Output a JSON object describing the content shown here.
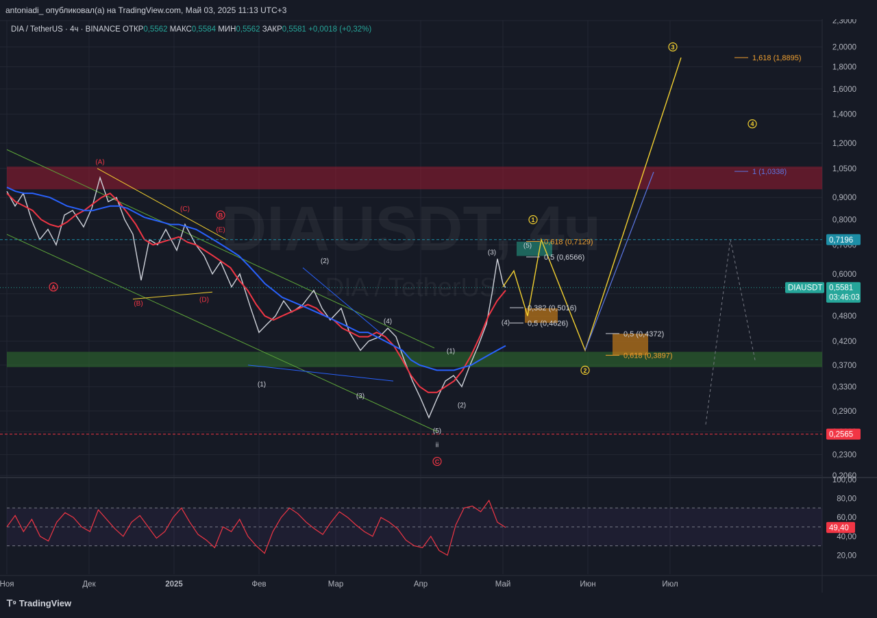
{
  "header": {
    "publisher": "antoniadi_ опубликовал(а) на TradingView.com, Май 03, 2025 11:13 UTC+3"
  },
  "legend": {
    "symbol": "DIA / TetherUS · 4ч · BINANCE",
    "open_label": "ОТКР",
    "open": "0,5562",
    "high_label": "МАКС",
    "high": "0,5584",
    "low_label": "МИН",
    "low": "0,5562",
    "close_label": "ЗАКР",
    "close": "0,5581",
    "change": "+0,0018 (+0,32%)"
  },
  "watermark": {
    "symbol": "DIAUSDT, 4ч",
    "name": "DIA / TetherUS"
  },
  "footer": {
    "brand": "TradingView"
  },
  "colors": {
    "background": "#161a25",
    "grid": "#232733",
    "candles": "#d1d4dc",
    "ma_fast": "#f23645",
    "ma_slow": "#2962ff",
    "projection": "#f5d230",
    "channel": "#5fa83a",
    "rsi": "#f23645",
    "resistance_zone": "#9b1c31",
    "support_zone": "#2e6b2e",
    "fib_box": "#b8741a",
    "price_tag": "#26a69a"
  },
  "chart_data": {
    "type": "line",
    "scale": "log",
    "y_ticks": [
      "2,3000",
      "2,0000",
      "1,8000",
      "1,6000",
      "1,4000",
      "1,2000",
      "1,0500",
      "0,9000",
      "0,8000",
      "0,7000",
      "0,6000",
      "0,5400",
      "0,4800",
      "0,4200",
      "0,3700",
      "0,3300",
      "0,2900",
      "0,2600",
      "0,2300",
      "0,2060"
    ],
    "y_tick_values": [
      2.3,
      2.0,
      1.8,
      1.6,
      1.4,
      1.2,
      1.05,
      0.9,
      0.8,
      0.7,
      0.6,
      0.54,
      0.48,
      0.42,
      0.37,
      0.33,
      0.29,
      0.26,
      0.23,
      0.206
    ],
    "x_ticks": [
      "Ноя",
      "Дек",
      "2025",
      "Фев",
      "Мар",
      "Апр",
      "Май",
      "Июн",
      "Июл"
    ],
    "x_tick_days": [
      0,
      30,
      61,
      92,
      120,
      151,
      181,
      212,
      242
    ],
    "price_path": [
      {
        "d": 0,
        "p": 0.93
      },
      {
        "d": 3,
        "p": 0.86
      },
      {
        "d": 6,
        "p": 0.92
      },
      {
        "d": 9,
        "p": 0.8
      },
      {
        "d": 12,
        "p": 0.72
      },
      {
        "d": 15,
        "p": 0.76
      },
      {
        "d": 18,
        "p": 0.7
      },
      {
        "d": 21,
        "p": 0.82
      },
      {
        "d": 24,
        "p": 0.84
      },
      {
        "d": 28,
        "p": 0.77
      },
      {
        "d": 31,
        "p": 0.85
      },
      {
        "d": 34,
        "p": 1.0
      },
      {
        "d": 37,
        "p": 0.88
      },
      {
        "d": 40,
        "p": 0.9
      },
      {
        "d": 43,
        "p": 0.8
      },
      {
        "d": 46,
        "p": 0.74
      },
      {
        "d": 49,
        "p": 0.58
      },
      {
        "d": 52,
        "p": 0.72
      },
      {
        "d": 55,
        "p": 0.7
      },
      {
        "d": 58,
        "p": 0.76
      },
      {
        "d": 62,
        "p": 0.68
      },
      {
        "d": 65,
        "p": 0.78
      },
      {
        "d": 69,
        "p": 0.7
      },
      {
        "d": 72,
        "p": 0.66
      },
      {
        "d": 75,
        "p": 0.6
      },
      {
        "d": 78,
        "p": 0.64
      },
      {
        "d": 82,
        "p": 0.56
      },
      {
        "d": 85,
        "p": 0.6
      },
      {
        "d": 89,
        "p": 0.5
      },
      {
        "d": 92,
        "p": 0.44
      },
      {
        "d": 95,
        "p": 0.46
      },
      {
        "d": 98,
        "p": 0.48
      },
      {
        "d": 101,
        "p": 0.52
      },
      {
        "d": 104,
        "p": 0.49
      },
      {
        "d": 108,
        "p": 0.51
      },
      {
        "d": 112,
        "p": 0.55
      },
      {
        "d": 115,
        "p": 0.5
      },
      {
        "d": 118,
        "p": 0.47
      },
      {
        "d": 122,
        "p": 0.5
      },
      {
        "d": 125,
        "p": 0.44
      },
      {
        "d": 129,
        "p": 0.4
      },
      {
        "d": 132,
        "p": 0.42
      },
      {
        "d": 136,
        "p": 0.43
      },
      {
        "d": 139,
        "p": 0.45
      },
      {
        "d": 142,
        "p": 0.43
      },
      {
        "d": 145,
        "p": 0.38
      },
      {
        "d": 148,
        "p": 0.34
      },
      {
        "d": 151,
        "p": 0.31
      },
      {
        "d": 154,
        "p": 0.28
      },
      {
        "d": 157,
        "p": 0.31
      },
      {
        "d": 160,
        "p": 0.34
      },
      {
        "d": 163,
        "p": 0.35
      },
      {
        "d": 166,
        "p": 0.33
      },
      {
        "d": 169,
        "p": 0.37
      },
      {
        "d": 172,
        "p": 0.41
      },
      {
        "d": 175,
        "p": 0.46
      },
      {
        "d": 177,
        "p": 0.54
      },
      {
        "d": 179,
        "p": 0.65
      },
      {
        "d": 181,
        "p": 0.57
      },
      {
        "d": 182,
        "p": 0.558
      }
    ],
    "series": [
      {
        "name": "",
        "color": "#f23645",
        "values": [
          0.92,
          0.88,
          0.86,
          0.84,
          0.8,
          0.78,
          0.77,
          0.79,
          0.82,
          0.84,
          0.87,
          0.9,
          0.92,
          0.88,
          0.83,
          0.78,
          0.72,
          0.7,
          0.71,
          0.72,
          0.73,
          0.71,
          0.7,
          0.68,
          0.66,
          0.64,
          0.62,
          0.58,
          0.55,
          0.51,
          0.48,
          0.47,
          0.48,
          0.49,
          0.5,
          0.51,
          0.5,
          0.48,
          0.47,
          0.45,
          0.44,
          0.43,
          0.43,
          0.44,
          0.43,
          0.41,
          0.38,
          0.35,
          0.33,
          0.32,
          0.32,
          0.33,
          0.34,
          0.36,
          0.39,
          0.43,
          0.48,
          0.52,
          0.55
        ]
      },
      {
        "name": "",
        "color": "#2962ff",
        "values": [
          0.95,
          0.93,
          0.92,
          0.92,
          0.91,
          0.9,
          0.88,
          0.86,
          0.85,
          0.84,
          0.84,
          0.85,
          0.86,
          0.86,
          0.85,
          0.83,
          0.81,
          0.8,
          0.79,
          0.78,
          0.78,
          0.77,
          0.76,
          0.74,
          0.72,
          0.7,
          0.68,
          0.66,
          0.63,
          0.6,
          0.57,
          0.55,
          0.53,
          0.52,
          0.51,
          0.5,
          0.49,
          0.48,
          0.47,
          0.46,
          0.45,
          0.44,
          0.44,
          0.43,
          0.42,
          0.41,
          0.4,
          0.38,
          0.37,
          0.365,
          0.36,
          0.36,
          0.36,
          0.365,
          0.37,
          0.38,
          0.39,
          0.4,
          0.41
        ]
      }
    ],
    "rsi_values": [
      50,
      62,
      45,
      58,
      40,
      35,
      55,
      65,
      60,
      50,
      45,
      68,
      58,
      48,
      40,
      55,
      62,
      50,
      38,
      45,
      60,
      70,
      55,
      42,
      36,
      28,
      50,
      45,
      58,
      40,
      30,
      22,
      45,
      60,
      70,
      64,
      55,
      48,
      42,
      55,
      66,
      60,
      52,
      45,
      40,
      60,
      55,
      48,
      36,
      30,
      28,
      40,
      25,
      20,
      52,
      70,
      72,
      66,
      78,
      55,
      49.4
    ],
    "rsi_ticks": [
      "100,00",
      "80,00",
      "60,00",
      "40,00",
      "20,00"
    ],
    "rsi_tick_values": [
      100,
      80,
      60,
      40,
      20
    ],
    "rsi_value": "49,40",
    "price_tags": [
      {
        "label": "0,7196",
        "value": 0.7196,
        "color": "#1d8ea6"
      },
      {
        "label": "0,5581",
        "value": 0.5581,
        "color": "#26a69a"
      },
      {
        "label": "0,2565",
        "value": 0.2565,
        "color": "#f23645"
      }
    ],
    "current_symbol": "DIAUSDT",
    "countdown": "03:46:03",
    "fib_labels": [
      {
        "text": "0,618 (0,7129)",
        "value": 0.7129,
        "d": 196,
        "color": "#f0a030"
      },
      {
        "text": "0,5 (0,6566)",
        "value": 0.6566,
        "d": 196,
        "color": "#d1d4dc"
      },
      {
        "text": "0,382 (0,5016)",
        "value": 0.5016,
        "d": 190,
        "color": "#d1d4dc"
      },
      {
        "text": "0,5 (0,4626)",
        "value": 0.4626,
        "d": 190,
        "color": "#d1d4dc"
      },
      {
        "text": "0,5 (0,4372)",
        "value": 0.4372,
        "d": 225,
        "color": "#d1d4dc"
      },
      {
        "text": "0,618 (0,3897)",
        "value": 0.3897,
        "d": 225,
        "color": "#f0a030"
      },
      {
        "text": "1,618 (1,8895)",
        "value": 1.8895,
        "d": 272,
        "color": "#f0a030"
      },
      {
        "text": "1 (1,0338)",
        "value": 1.0338,
        "d": 272,
        "color": "#5c78e6"
      }
    ],
    "wave_labels": [
      {
        "text": "(A)",
        "d": 34,
        "value": 1.09,
        "color": "#f23645"
      },
      {
        "text": "A",
        "d": 17,
        "value": 0.56,
        "color": "#f23645",
        "circle": true
      },
      {
        "text": "(B)",
        "d": 48,
        "value": 0.515,
        "color": "#f23645"
      },
      {
        "text": "(C)",
        "d": 65,
        "value": 0.85,
        "color": "#f23645"
      },
      {
        "text": "(D)",
        "d": 72,
        "value": 0.525,
        "color": "#f23645"
      },
      {
        "text": "B",
        "d": 78,
        "value": 0.82,
        "color": "#f23645",
        "circle": true
      },
      {
        "text": "(E)",
        "d": 78,
        "value": 0.76,
        "color": "#f23645"
      },
      {
        "text": "(1)",
        "d": 93,
        "value": 0.335,
        "color": "#d1d4dc"
      },
      {
        "text": "(2)",
        "d": 116,
        "value": 0.645,
        "color": "#d1d4dc"
      },
      {
        "text": "(3)",
        "d": 129,
        "value": 0.315,
        "color": "#d1d4dc"
      },
      {
        "text": "(4)",
        "d": 139,
        "value": 0.468,
        "color": "#d1d4dc"
      },
      {
        "text": "(5)",
        "d": 157,
        "value": 0.262,
        "color": "#d1d4dc"
      },
      {
        "text": "ii",
        "d": 157,
        "value": 0.243,
        "color": "#d1d4dc"
      },
      {
        "text": "C",
        "d": 157,
        "value": 0.222,
        "color": "#f23645",
        "circle": true
      },
      {
        "text": "(1)",
        "d": 162,
        "value": 0.4,
        "color": "#d1d4dc"
      },
      {
        "text": "(2)",
        "d": 166,
        "value": 0.3,
        "color": "#d1d4dc"
      },
      {
        "text": "(3)",
        "d": 177,
        "value": 0.675,
        "color": "#d1d4dc"
      },
      {
        "text": "(4)",
        "d": 182,
        "value": 0.465,
        "color": "#d1d4dc"
      },
      {
        "text": "(5)",
        "d": 190,
        "value": 0.7,
        "color": "#d1d4dc"
      },
      {
        "text": "1",
        "d": 192,
        "value": 0.8,
        "color": "#f5d230",
        "circle": true
      },
      {
        "text": "2",
        "d": 211,
        "value": 0.36,
        "color": "#f5d230",
        "circle": true
      },
      {
        "text": "3",
        "d": 243,
        "value": 2.0,
        "color": "#f5d230",
        "circle": true
      },
      {
        "text": "4",
        "d": 272,
        "value": 1.33,
        "color": "#f5d230",
        "circle": true
      }
    ]
  }
}
